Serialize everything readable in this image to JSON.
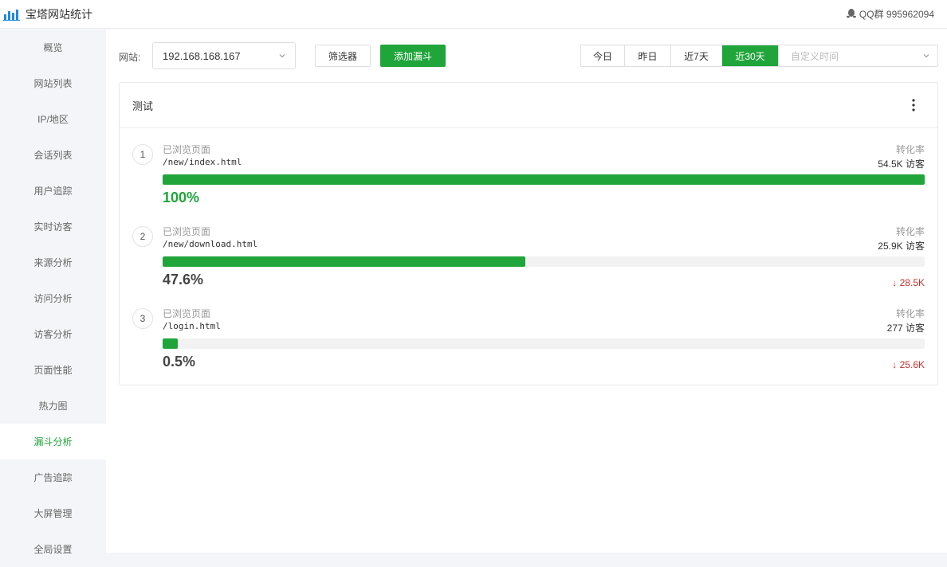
{
  "app": {
    "title": "宝塔网站统计",
    "qq_group": "QQ群 995962094"
  },
  "sidebar": {
    "items": [
      {
        "label": "概览"
      },
      {
        "label": "网站列表"
      },
      {
        "label": "IP/地区"
      },
      {
        "label": "会话列表"
      },
      {
        "label": "用户追踪"
      },
      {
        "label": "实时访客"
      },
      {
        "label": "来源分析"
      },
      {
        "label": "访问分析"
      },
      {
        "label": "访客分析"
      },
      {
        "label": "页面性能"
      },
      {
        "label": "热力图"
      },
      {
        "label": "漏斗分析",
        "active": true
      },
      {
        "label": "广告追踪"
      },
      {
        "label": "大屏管理"
      },
      {
        "label": "全局设置"
      }
    ]
  },
  "toolbar": {
    "site_label": "网站:",
    "site_value": "192.168.168.167",
    "filter_label": "筛选器",
    "add_funnel_label": "添加漏斗",
    "ranges": [
      {
        "label": "今日"
      },
      {
        "label": "昨日"
      },
      {
        "label": "近7天"
      },
      {
        "label": "近30天",
        "active": true
      }
    ],
    "custom_placeholder": "自定义时间"
  },
  "funnel": {
    "title": "测试",
    "steps": [
      {
        "num": "1",
        "label": "已浏览页面",
        "path": "/new/index.html",
        "rate_label": "转化率",
        "visitors": "54.5K 访客",
        "percent": "100%",
        "fraction": 1.0,
        "drop": ""
      },
      {
        "num": "2",
        "label": "已浏览页面",
        "path": "/new/download.html",
        "rate_label": "转化率",
        "visitors": "25.9K 访客",
        "percent": "47.6%",
        "fraction": 0.476,
        "drop": "↓ 28.5K"
      },
      {
        "num": "3",
        "label": "已浏览页面",
        "path": "/login.html",
        "rate_label": "转化率",
        "visitors": "277 访客",
        "percent": "0.5%",
        "fraction": 0.005,
        "drop": "↓ 25.6K"
      }
    ]
  },
  "colors": {
    "accent": "#20a53a",
    "drop": "#c9302c"
  }
}
